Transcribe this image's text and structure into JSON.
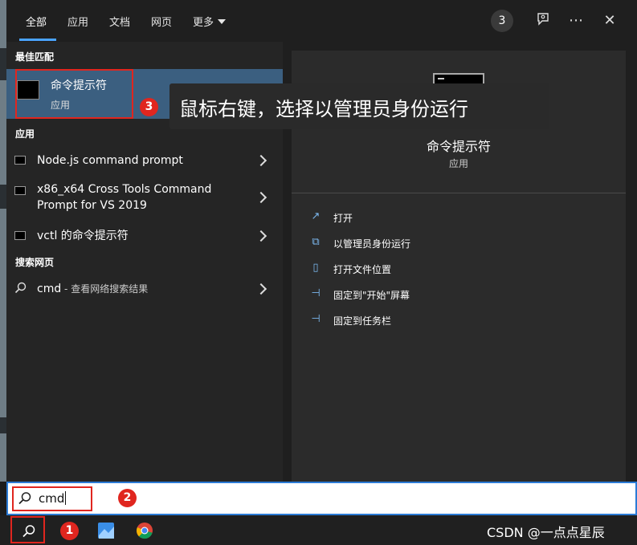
{
  "tabs": [
    {
      "label": "全部",
      "active": true
    },
    {
      "label": "应用",
      "active": false
    },
    {
      "label": "文档",
      "active": false
    },
    {
      "label": "网页",
      "active": false
    },
    {
      "label": "更多",
      "active": false
    }
  ],
  "header": {
    "badge_count": "3",
    "icons": [
      "feedback-icon",
      "more-options-icon",
      "close-icon"
    ]
  },
  "best_match": {
    "section_title": "最佳匹配",
    "name": "命令提示符",
    "type": "应用"
  },
  "apps": {
    "section_title": "应用",
    "items": [
      {
        "label": "Node.js command prompt"
      },
      {
        "label": "x86_x64 Cross Tools Command Prompt for VS 2019"
      },
      {
        "label": "vctl 的命令提示符"
      }
    ]
  },
  "web": {
    "section_title": "搜索网页",
    "query": "cmd",
    "suffix": " - 查看网络搜索结果"
  },
  "detail": {
    "name": "命令提示符",
    "type": "应用",
    "actions": [
      {
        "label": "打开",
        "icon": "open-icon"
      },
      {
        "label": "以管理员身份运行",
        "icon": "admin-shield-icon"
      },
      {
        "label": "打开文件位置",
        "icon": "file-location-icon"
      },
      {
        "label": "固定到\"开始\"屏幕",
        "icon": "pin-icon"
      },
      {
        "label": "固定到任务栏",
        "icon": "pin-icon"
      }
    ]
  },
  "search": {
    "value": "cmd"
  },
  "annotations": {
    "callout_text": "鼠标右键，选择以管理员身份运行",
    "markers": [
      "1",
      "2",
      "3"
    ],
    "color": "#e0261f"
  },
  "watermark": "CSDN @一点点星辰",
  "colors": {
    "accent": "#4aa3ff",
    "selected_bg": "#3b5f80",
    "search_border": "#2b7bd6"
  }
}
